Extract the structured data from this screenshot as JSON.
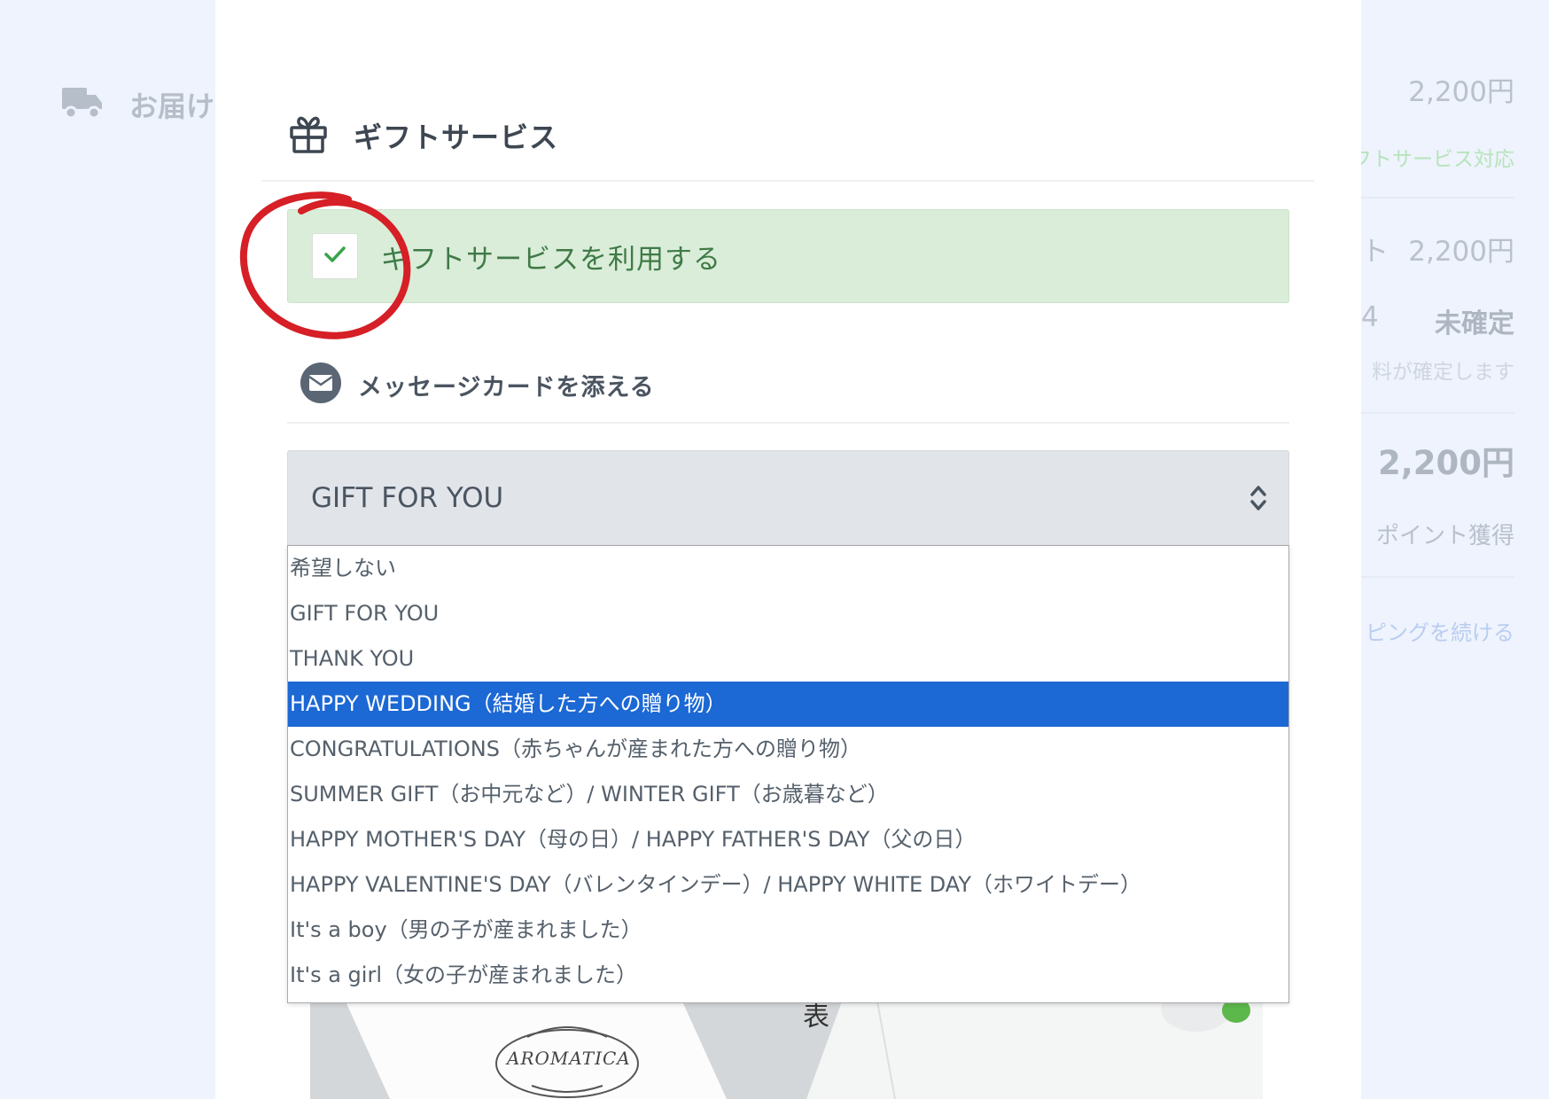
{
  "background": {
    "delivery_label": "お届け",
    "right_column": {
      "price_1": "2,200円",
      "gift_service_note": "フトサービス対応",
      "subtotal_fragment": "ト",
      "price_2": "2,200円",
      "shipping_fragment": "4",
      "shipping_value": "未確定",
      "shipping_note": "料が確定します",
      "total": "2,200円",
      "points": "ポイント獲得",
      "continue_link": "ピングを続ける"
    }
  },
  "modal": {
    "header": {
      "icon": "gift-icon",
      "title": "ギフトサービス"
    },
    "gift_checkbox": {
      "checked": true,
      "label": "ギフトサービスを利用する"
    },
    "message_card": {
      "icon": "envelope-icon",
      "label": "メッセージカードを添える"
    },
    "select": {
      "value": "GIFT FOR YOU",
      "selected_index": 3,
      "options": [
        "希望しない",
        "GIFT FOR YOU",
        "THANK YOU",
        "HAPPY WEDDING（結婚した方への贈り物）",
        "CONGRATULATIONS（赤ちゃんが産まれた方への贈り物）",
        "SUMMER GIFT（お中元など）/ WINTER GIFT（お歳暮など）",
        "HAPPY MOTHER'S DAY（母の日）/ HAPPY FATHER'S DAY（父の日）",
        "HAPPY VALENTINE'S DAY（バレンタインデー）/ HAPPY WHITE DAY（ホワイトデー）",
        "It's a boy（男の子が産まれました）",
        "It's a girl（女の子が産まれました）"
      ]
    },
    "preview": {
      "side_label": "表",
      "stamp_text": "AROMATICA"
    }
  },
  "colors": {
    "page_background": "#eef3fd",
    "checkbox_row_background": "#daedd9",
    "check_color": "#3aa34a",
    "annotation_red": "#d61f26",
    "option_selected": "#1c68d4"
  }
}
